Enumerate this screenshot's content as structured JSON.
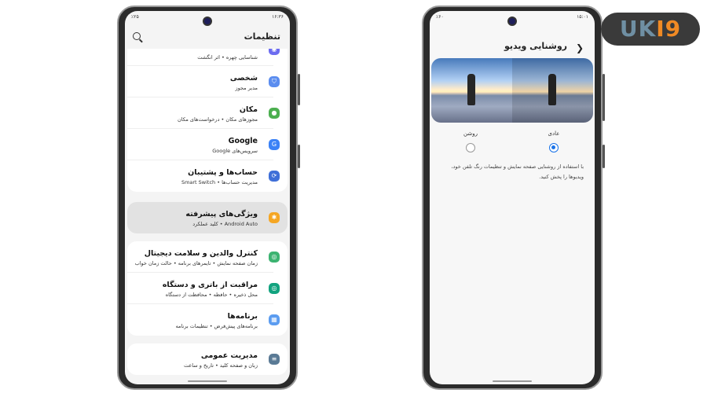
{
  "left": {
    "status": {
      "time": "۱۶:۳۶",
      "battery": "٪۲۵"
    },
    "title": "تنظیمات",
    "cards": [
      {
        "items": [
          {
            "title": "",
            "subtitle": "شناسایی چهره • اثر انگشت",
            "icon": "fingerprint-icon",
            "color": "#6c6cf0"
          },
          {
            "title": "شخصی",
            "subtitle": "مدیر مجوز",
            "icon": "shield-icon",
            "color": "#5b8def"
          },
          {
            "title": "مکان",
            "subtitle": "مجوزهای مکان • درخواست‌های مکان",
            "icon": "location-icon",
            "color": "#4caf50"
          },
          {
            "title": "Google",
            "subtitle": "سرویس‌های Google",
            "icon": "google-icon",
            "color": "#3b82f6"
          },
          {
            "title": "حساب‌ها و پشتیبان",
            "subtitle": "مدیریت حساب‌ها • Smart Switch",
            "icon": "sync-icon",
            "color": "#3f6fd8"
          }
        ]
      },
      {
        "items": [
          {
            "title": "ویژگی‌های پیشرفته",
            "subtitle": "Android Auto • کلید عملکرد",
            "icon": "gear-plus-icon",
            "color": "#f5a623"
          }
        ]
      },
      {
        "items": [
          {
            "title": "کنترل والدین و سلامت دیجیتال",
            "subtitle": "زمان صفحه نمایش • تایمرهای برنامه • حالت زمان خواب",
            "icon": "wellbeing-icon",
            "color": "#3cb371"
          },
          {
            "title": "مراقبت از باتری و دستگاه",
            "subtitle": "محل ذخیره • حافظه • محافظت از دستگاه",
            "icon": "device-care-icon",
            "color": "#12a37f"
          },
          {
            "title": "برنامه‌ها",
            "subtitle": "برنامه‌های پیش‌فرض • تنظیمات برنامه",
            "icon": "apps-icon",
            "color": "#5b9cf0"
          }
        ]
      },
      {
        "items": [
          {
            "title": "مدیریت عمومی",
            "subtitle": "زبان و صفحه کلید • تاریخ و ساعت",
            "icon": "sliders-icon",
            "color": "#5a7a95"
          }
        ]
      }
    ]
  },
  "right": {
    "status": {
      "time": "۱۵:۰۱",
      "battery": "٪۶۰"
    },
    "title": "روشنایی ویدیو",
    "options": [
      {
        "label": "عادی",
        "selected": true
      },
      {
        "label": "روشن",
        "selected": false
      }
    ],
    "description": "با استفاده از روشنایی صفحه نمایش و تنظیمات رنگ تلفن خود، ویدیوها را پخش کنید."
  },
  "logo": {
    "text": "UKI9",
    "accent": "#f08a24"
  }
}
